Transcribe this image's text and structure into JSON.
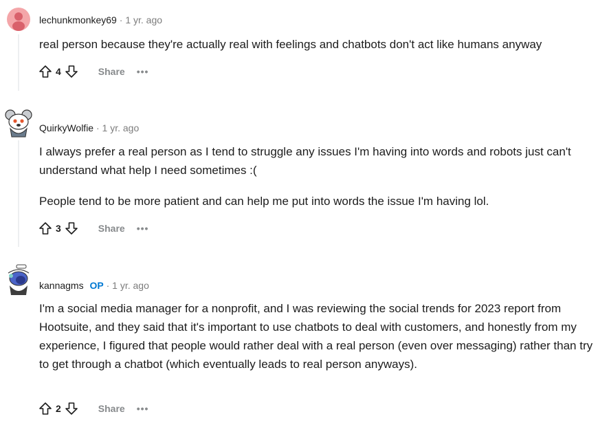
{
  "comments": [
    {
      "username": "lechunkmonkey69",
      "separator": "·",
      "time": "1 yr. ago",
      "paragraphs": [
        "real person because they're actually real with feelings and chatbots don't act like humans anyway"
      ],
      "votes": "4",
      "share_label": "Share",
      "more_label": "•••"
    },
    {
      "username": "QuirkyWolfie",
      "separator": "·",
      "time": "1 yr. ago",
      "paragraphs": [
        "I always prefer a real person as I tend to struggle any issues I'm having into words and robots just can't understand what help I need sometimes :(",
        "People tend to be more patient and can help me put into words the issue I'm having lol."
      ],
      "votes": "3",
      "share_label": "Share",
      "more_label": "•••"
    },
    {
      "username": "kannagms",
      "op_badge": "OP",
      "separator": "·",
      "time": "1 yr. ago",
      "paragraphs": [
        "I'm a social media manager for a nonprofit, and I was reviewing the social trends for 2023 report from Hootsuite, and they said that it's important to use chatbots to deal with customers, and honestly from my experience, I figured that people would rather deal with a real person (even over messaging) rather than try to get through a chatbot (which eventually leads to real person anyways)."
      ],
      "votes": "2",
      "share_label": "Share",
      "more_label": "•••"
    }
  ],
  "colors": {
    "op_badge": "#0079d3",
    "meta_muted": "#7c7c7c",
    "action_muted": "#878a8c",
    "thread_line": "#edeff1"
  }
}
